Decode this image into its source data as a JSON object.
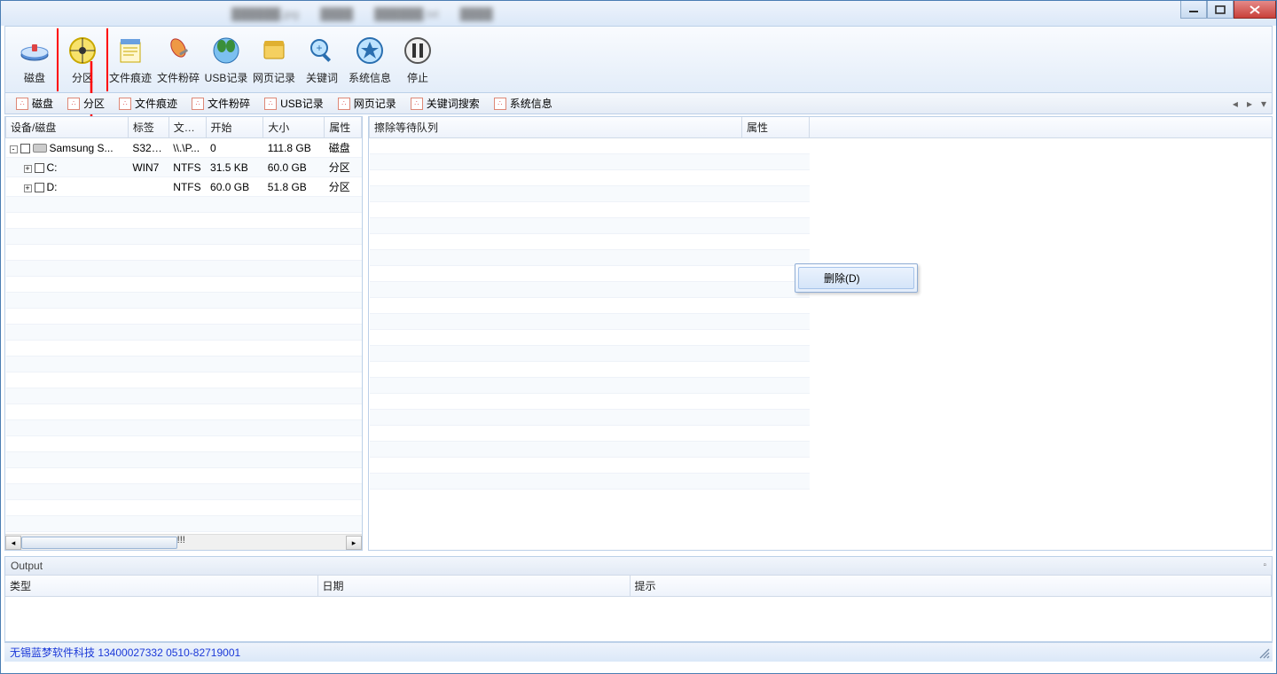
{
  "toolbar": {
    "items": [
      "磁盘",
      "分区",
      "文件痕迹",
      "文件粉碎",
      "USB记录",
      "网页记录",
      "关键词",
      "系统信息",
      "停止"
    ]
  },
  "subbar": {
    "items": [
      "磁盘",
      "分区",
      "文件痕迹",
      "文件粉碎",
      "USB记录",
      "网页记录",
      "关键词搜索",
      "系统信息"
    ]
  },
  "left_panel": {
    "headers": [
      "设备/磁盘",
      "标签",
      "文件...",
      "开始",
      "大小",
      "属性"
    ],
    "rows": [
      {
        "indent": 0,
        "expand": "-",
        "check": true,
        "icon": true,
        "name": "Samsung S...",
        "label": "S32K...",
        "fs": "\\\\.\\P...",
        "start": "0",
        "size": "111.8 GB",
        "attr": "磁盘"
      },
      {
        "indent": 1,
        "expand": "+",
        "check": true,
        "icon": false,
        "name": "C:",
        "label": "WIN7",
        "fs": "NTFS",
        "start": "31.5 KB",
        "size": "60.0 GB",
        "attr": "分区"
      },
      {
        "indent": 1,
        "expand": "+",
        "check": true,
        "icon": false,
        "name": "D:",
        "label": "",
        "fs": "NTFS",
        "start": "60.0 GB",
        "size": "51.8 GB",
        "attr": "分区"
      }
    ],
    "scroll_pos": "!!!"
  },
  "right_panel": {
    "headers": [
      "擦除等待队列",
      "属性"
    ],
    "context_menu": "删除(D)"
  },
  "output": {
    "title": "Output",
    "headers": [
      "类型",
      "日期",
      "提示"
    ]
  },
  "statusbar": "无锡蓝梦软件科技 13400027332  0510-82719001"
}
